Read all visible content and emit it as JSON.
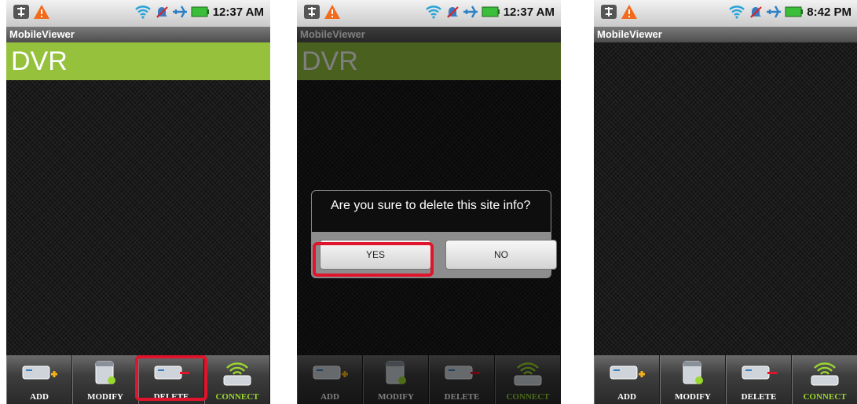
{
  "screens": [
    {
      "statusbar": {
        "time": "12:37 AM"
      },
      "app_title": "MobileViewer",
      "site_item": "DVR",
      "toolbar": [
        {
          "label": "ADD",
          "icon": "add-icon"
        },
        {
          "label": "MODIFY",
          "icon": "modify-icon"
        },
        {
          "label": "DELETE",
          "icon": "delete-icon"
        },
        {
          "label": "CONNECT",
          "icon": "connect-icon"
        }
      ]
    },
    {
      "statusbar": {
        "time": "12:37 AM"
      },
      "app_title": "MobileViewer",
      "site_item": "DVR",
      "dialog": {
        "message": "Are you sure to delete this site info?",
        "yes": "YES",
        "no": "NO"
      },
      "toolbar": [
        {
          "label": "ADD",
          "icon": "add-icon"
        },
        {
          "label": "MODIFY",
          "icon": "modify-icon"
        },
        {
          "label": "DELETE",
          "icon": "delete-icon"
        },
        {
          "label": "CONNECT",
          "icon": "connect-icon"
        }
      ]
    },
    {
      "statusbar": {
        "time": "8:42 PM"
      },
      "app_title": "MobileViewer",
      "toolbar": [
        {
          "label": "ADD",
          "icon": "add-icon"
        },
        {
          "label": "MODIFY",
          "icon": "modify-icon"
        },
        {
          "label": "DELETE",
          "icon": "delete-icon"
        },
        {
          "label": "CONNECT",
          "icon": "connect-icon"
        }
      ]
    }
  ],
  "colors": {
    "accent_green": "#95c13c",
    "highlight_red": "#e0142b",
    "connect_green": "#9bd82f"
  }
}
